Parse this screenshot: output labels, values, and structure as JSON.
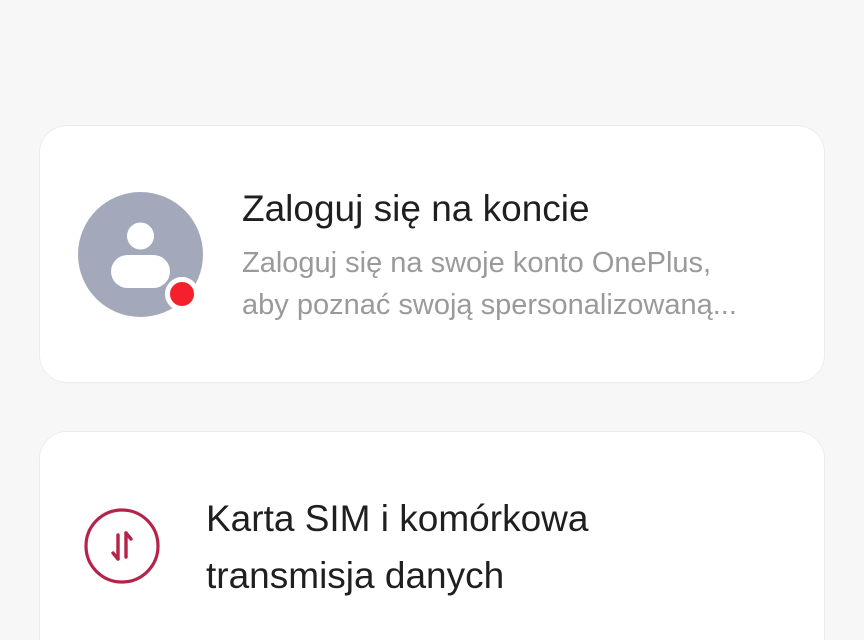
{
  "account": {
    "title": "Zaloguj się na koncie",
    "subtitle_line1": "Zaloguj się na swoje konto OnePlus,",
    "subtitle_line2": "aby poznać swoją spersonalizowaną...",
    "avatar_color": "#a3a9ba",
    "badge_color": "#f4202c",
    "icons": [
      "user-avatar-icon",
      "notification-dot"
    ]
  },
  "sim": {
    "title_line1": "Karta SIM i komórkowa",
    "title_line2": "transmisja danych",
    "icon": "data-transfer-icon",
    "icon_color": "#b5234a"
  }
}
